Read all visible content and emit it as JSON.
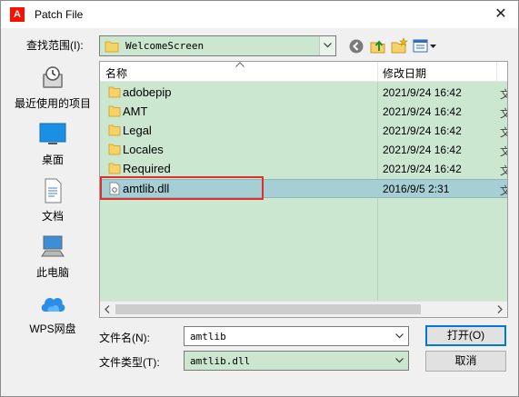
{
  "window": {
    "title": "Patch File",
    "app_icon": "adobe-icon",
    "close_glyph": "✕"
  },
  "lookin": {
    "label": "查找范围(I):",
    "value": "WelcomeScreen"
  },
  "places": [
    {
      "label": "最近使用的项目",
      "icon": "recent-icon"
    },
    {
      "label": "桌面",
      "icon": "desktop-icon"
    },
    {
      "label": "文档",
      "icon": "documents-icon"
    },
    {
      "label": "此电脑",
      "icon": "computer-icon"
    },
    {
      "label": "WPS网盘",
      "icon": "cloud-icon"
    }
  ],
  "filelist": {
    "columns": [
      "名称",
      "修改日期"
    ],
    "rows": [
      {
        "name": "adobepip",
        "date": "2021/9/24 16:42",
        "type": "folder"
      },
      {
        "name": "AMT",
        "date": "2021/9/24 16:42",
        "type": "folder"
      },
      {
        "name": "Legal",
        "date": "2021/9/24 16:42",
        "type": "folder"
      },
      {
        "name": "Locales",
        "date": "2021/9/24 16:42",
        "type": "folder"
      },
      {
        "name": "Required",
        "date": "2021/9/24 16:42",
        "type": "folder"
      },
      {
        "name": "amtlib.dll",
        "date": "2016/9/5 2:31",
        "type": "file",
        "selected": true
      }
    ]
  },
  "filename": {
    "label": "文件名(N):",
    "value": "amtlib"
  },
  "filetype": {
    "label": "文件类型(T):",
    "value": "amtlib.dll"
  },
  "buttons": {
    "open": "打开(O)",
    "cancel": "取消"
  },
  "colors": {
    "list_bg": "#cce7d0",
    "selection": "#a5cfd4",
    "highlight_box": "#e0302c",
    "accent": "#0078d7"
  }
}
